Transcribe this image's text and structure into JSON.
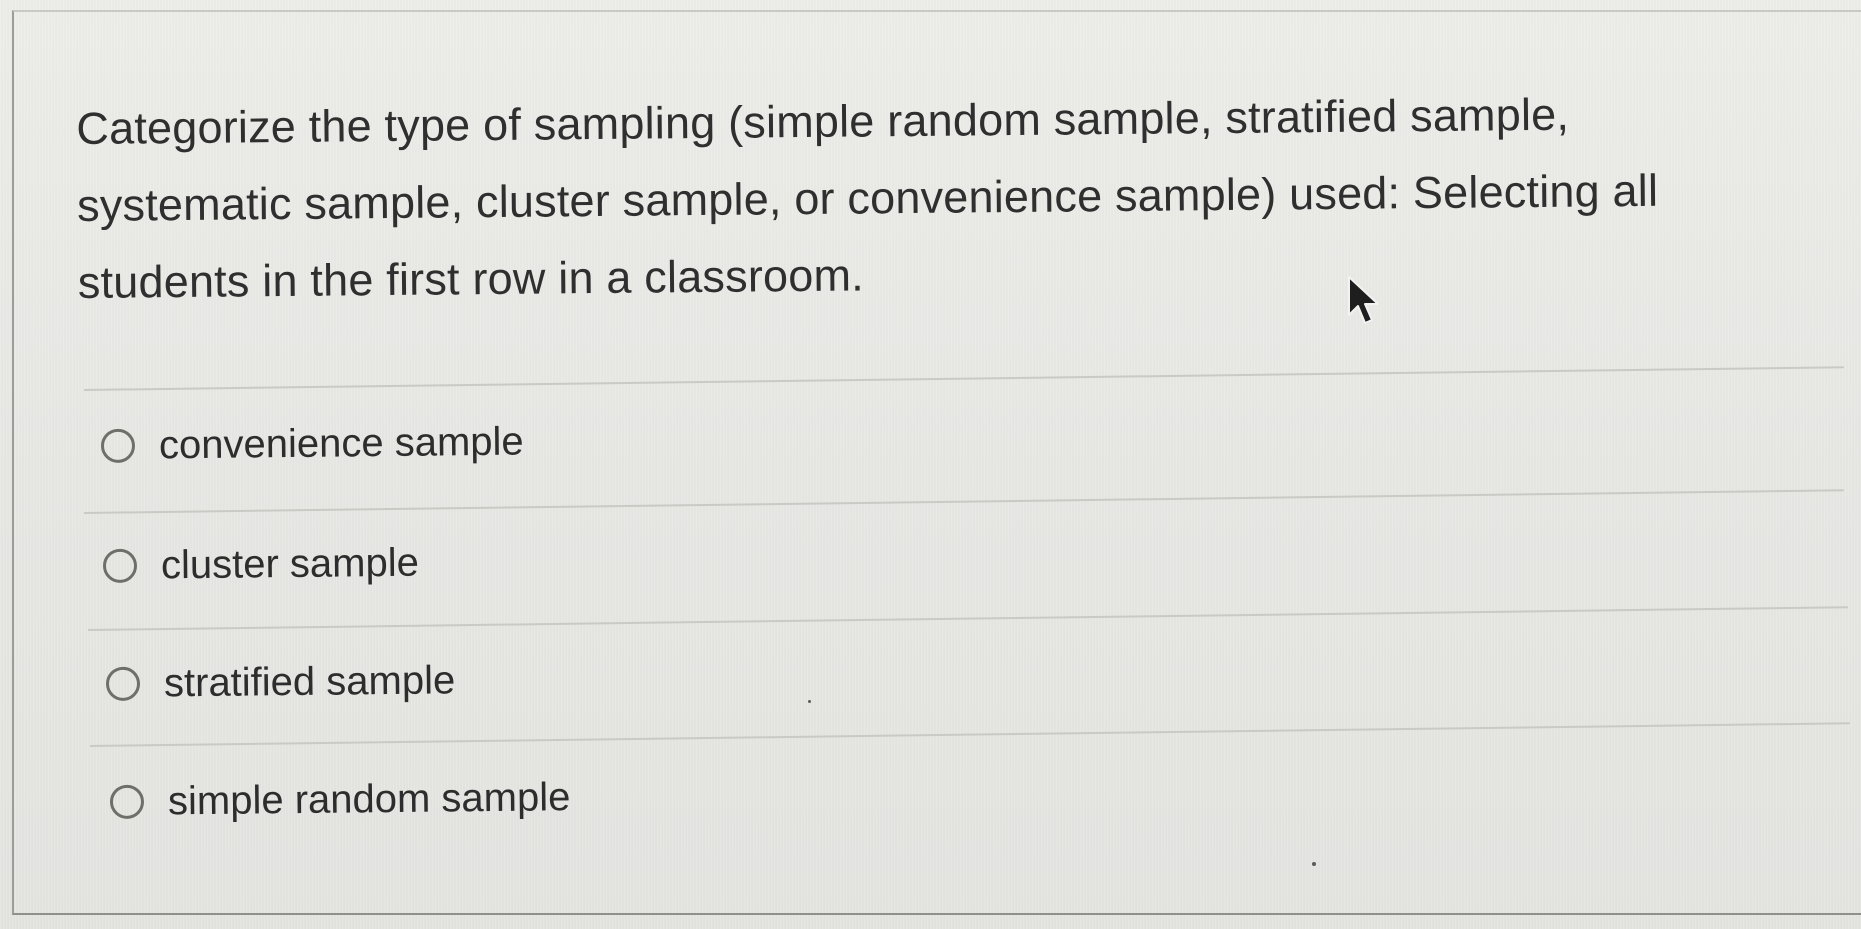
{
  "question": {
    "text": "Categorize the type of sampling (simple random sample, stratified sample, systematic sample, cluster sample, or convenience sample) used: Selecting all students in the first row in a classroom."
  },
  "options": [
    {
      "label": "convenience sample",
      "selected": false
    },
    {
      "label": "cluster sample",
      "selected": false
    },
    {
      "label": "stratified sample",
      "selected": false
    },
    {
      "label": "simple random sample",
      "selected": false
    }
  ],
  "icons": {
    "radio": "radio-unchecked-icon",
    "cursor": "mouse-pointer-icon"
  },
  "colors": {
    "background": "#e9e9e6",
    "text": "#2f2f2f",
    "divider": "#c9c9c5",
    "radio_border": "#6e6e6b"
  }
}
